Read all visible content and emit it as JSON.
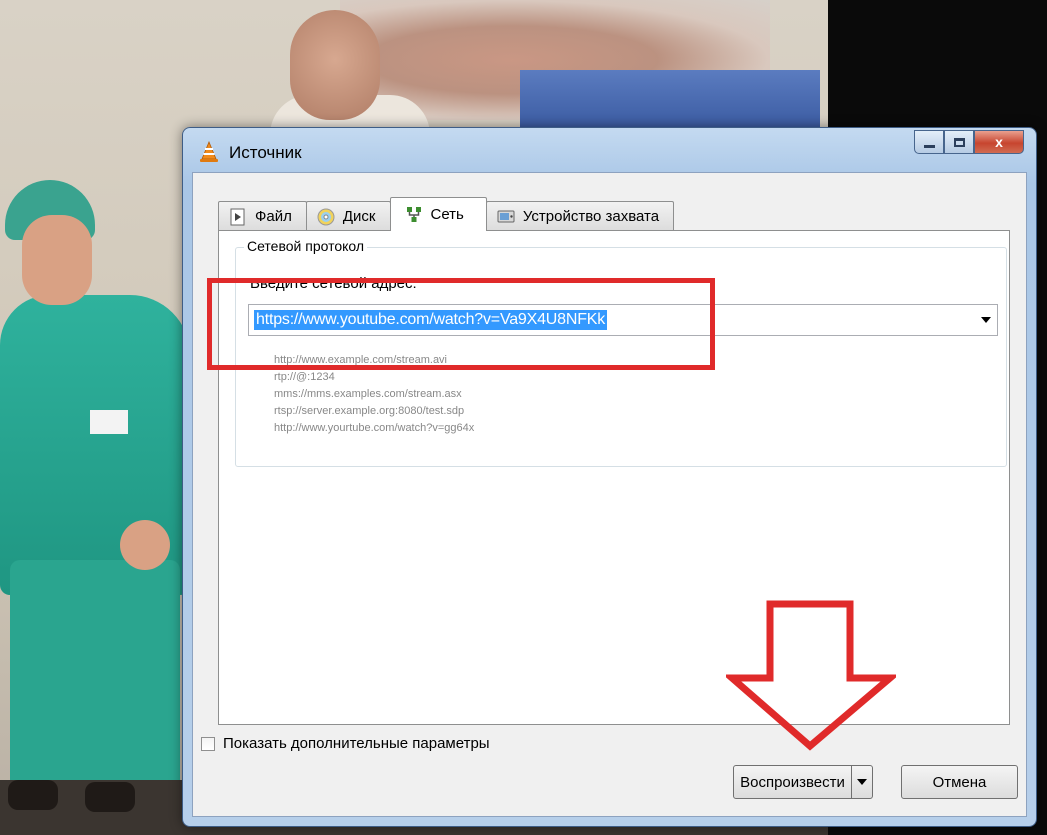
{
  "window": {
    "title": "Источник",
    "caption_minimize": "minimize",
    "caption_maximize": "maximize",
    "caption_close": "x"
  },
  "tabs": [
    {
      "label": "Файл",
      "icon": "file-play-icon",
      "active": false
    },
    {
      "label": "Диск",
      "icon": "disc-icon",
      "active": false
    },
    {
      "label": "Сеть",
      "icon": "network-icon",
      "active": true
    },
    {
      "label": "Устройство захвата",
      "icon": "capture-device-icon",
      "active": false
    }
  ],
  "network": {
    "group_title": "Сетевой протокол",
    "address_label": "Введите сетевой адрес:",
    "address_value": "https://www.youtube.com/watch?v=Va9X4U8NFKk",
    "examples": [
      "http://www.example.com/stream.avi",
      "rtp://@:1234",
      "mms://mms.examples.com/stream.asx",
      "rtsp://server.example.org:8080/test.sdp",
      "http://www.yourtube.com/watch?v=gg64x"
    ]
  },
  "options": {
    "show_more_label": "Показать дополнительные параметры",
    "show_more_checked": false
  },
  "buttons": {
    "play_label": "Воспроизвести",
    "cancel_label": "Отмена"
  },
  "colors": {
    "annotation_red": "#e02a2a",
    "selection_blue": "#3399ff",
    "titlebar_blue": "#b6cfea"
  }
}
